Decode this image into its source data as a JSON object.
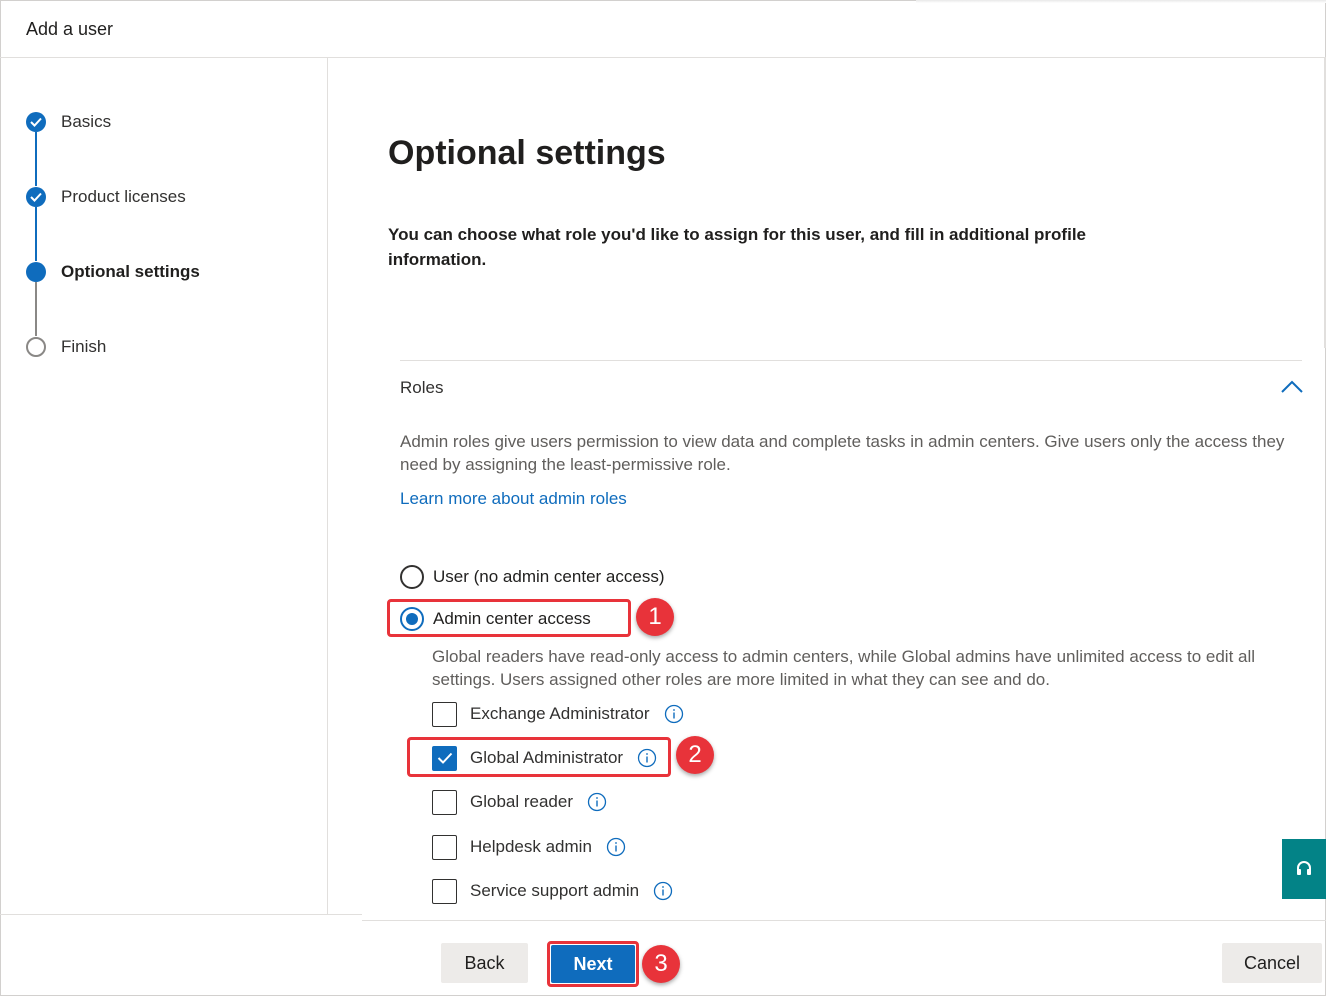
{
  "header": {
    "title": "Add a user"
  },
  "steps": [
    {
      "label": "Basics",
      "state": "done"
    },
    {
      "label": "Product licenses",
      "state": "done"
    },
    {
      "label": "Optional settings",
      "state": "current"
    },
    {
      "label": "Finish",
      "state": "pending"
    }
  ],
  "main": {
    "title": "Optional settings",
    "description": "You can choose what role you'd like to assign for this user, and fill in additional profile information."
  },
  "roles": {
    "title": "Roles",
    "description": "Admin roles give users permission to view data and complete tasks in admin centers. Give users only the access they need by assigning the least-permissive role.",
    "learn_more": "Learn more about admin roles",
    "options": [
      {
        "label": "User (no admin center access)",
        "selected": false
      },
      {
        "label": "Admin center access",
        "selected": true
      }
    ],
    "access_description": "Global readers have read-only access to admin centers, while Global admins have unlimited access to edit all settings. Users assigned other roles are more limited in what they can see and do.",
    "role_list": [
      {
        "label": "Exchange Administrator",
        "checked": false
      },
      {
        "label": "Global Administrator",
        "checked": true
      },
      {
        "label": "Global reader",
        "checked": false
      },
      {
        "label": "Helpdesk admin",
        "checked": false
      },
      {
        "label": "Service support admin",
        "checked": false
      }
    ]
  },
  "callouts": [
    "1",
    "2",
    "3"
  ],
  "footer": {
    "back": "Back",
    "next": "Next",
    "cancel": "Cancel"
  },
  "colors": {
    "accent": "#0f6cbd",
    "callout": "#e8333a",
    "help": "#038387"
  }
}
